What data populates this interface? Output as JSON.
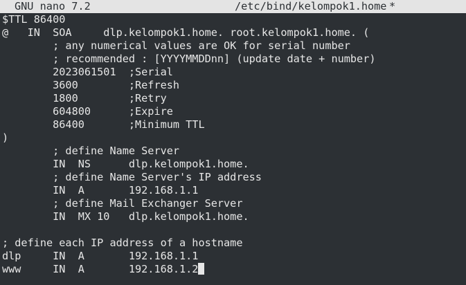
{
  "titlebar": {
    "app": "GNU nano 7.2",
    "filename": "/etc/bind/kelompok1.home",
    "modified": "*"
  },
  "editor": {
    "lines": [
      "$TTL 86400",
      "@   IN  SOA     dlp.kelompok1.home. root.kelompok1.home. (",
      "        ; any numerical values are OK for serial number",
      "        ; recommended : [YYYYMMDDnn] (update date + number)",
      "        2023061501  ;Serial",
      "        3600        ;Refresh",
      "        1800        ;Retry",
      "        604800      ;Expire",
      "        86400       ;Minimum TTL",
      ")",
      "        ; define Name Server",
      "        IN  NS      dlp.kelompok1.home.",
      "        ; define Name Server's IP address",
      "        IN  A       192.168.1.1",
      "        ; define Mail Exchanger Server",
      "        IN  MX 10   dlp.kelompok1.home.",
      "",
      "; define each IP address of a hostname",
      "dlp     IN  A       192.168.1.1",
      "www     IN  A       192.168.1.2"
    ]
  }
}
